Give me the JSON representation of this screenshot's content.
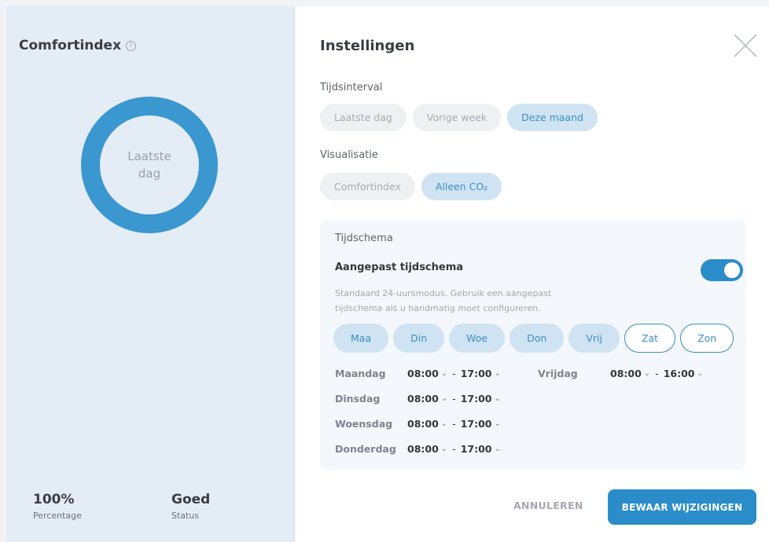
{
  "comfort": {
    "title": "Comfortindex",
    "ring_label_line1": "Laatste",
    "ring_label_line2": "dag",
    "percentage_value": "100%",
    "percentage_label": "Percentage",
    "status_value": "Goed",
    "status_label": "Status",
    "ring_fill_fraction": 1.0,
    "ring_color": "#3a97cf"
  },
  "settings": {
    "title": "Instellingen",
    "interval_label": "Tijdsinterval",
    "interval_options": [
      {
        "label": "Laatste dag",
        "active": false
      },
      {
        "label": "Vorige week",
        "active": false
      },
      {
        "label": "Deze maand",
        "active": true
      }
    ],
    "visual_label": "Visualisatie",
    "visual_options": [
      {
        "label": "Comfortindex",
        "active": false
      },
      {
        "label": "Alleen CO₂",
        "active": true
      }
    ],
    "schedule": {
      "label": "Tijdschema",
      "heading": "Aangepast tijdschema",
      "toggle_on": true,
      "description": "Standaard 24-uursmodus. Gebruik een aangepast tijdschema als u handmatig moet configureren.",
      "days": [
        {
          "label": "Maa",
          "active": true
        },
        {
          "label": "Din",
          "active": true
        },
        {
          "label": "Woe",
          "active": true
        },
        {
          "label": "Don",
          "active": true
        },
        {
          "label": "Vrij",
          "active": true
        },
        {
          "label": "Zat",
          "active": false
        },
        {
          "label": "Zon",
          "active": false
        }
      ],
      "rows": [
        {
          "day": "Maandag",
          "start": "08:00",
          "end": "17:00"
        },
        {
          "day": "Dinsdag",
          "start": "08:00",
          "end": "17:00"
        },
        {
          "day": "Woensdag",
          "start": "08:00",
          "end": "17:00"
        },
        {
          "day": "Donderdag",
          "start": "08:00",
          "end": "17:00"
        },
        {
          "day": "Vrijdag",
          "start": "08:00",
          "end": "16:00"
        }
      ]
    },
    "cancel_label": "ANNULEREN",
    "save_label": "BEWAAR WIJZIGINGEN"
  },
  "colors": {
    "accent": "#2a8dc9",
    "pill_active_bg": "#cfe3f2",
    "left_panel_bg": "#e4ecf5"
  }
}
